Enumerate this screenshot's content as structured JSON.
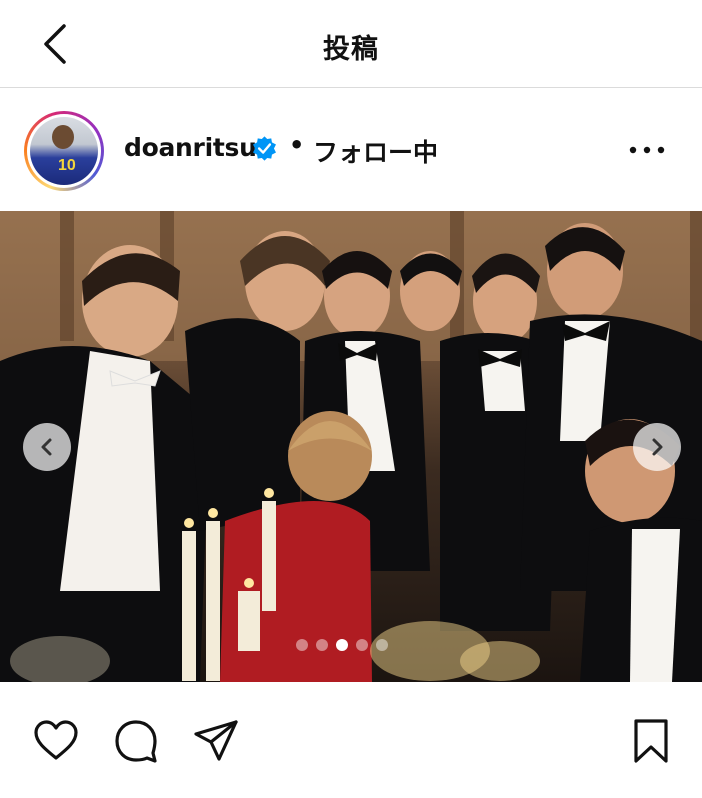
{
  "header": {
    "title": "投稿",
    "back_icon": "chevron-left-icon"
  },
  "post": {
    "username": "doanritsu",
    "verified_icon": "verified-badge-icon",
    "separator": "•",
    "follow_status": "フォロー中",
    "more_icon": "more-horizontal-icon",
    "avatar_jersey_number": "10"
  },
  "carousel": {
    "total_slides": 5,
    "active_slide": 3,
    "prev_icon": "chevron-left-icon",
    "next_icon": "chevron-right-icon"
  },
  "actions": {
    "like_icon": "heart-icon",
    "comment_icon": "comment-icon",
    "share_icon": "paper-plane-icon",
    "save_icon": "bookmark-icon"
  },
  "colors": {
    "verified_blue": "#0095f6",
    "divider": "#dbdbdb"
  }
}
